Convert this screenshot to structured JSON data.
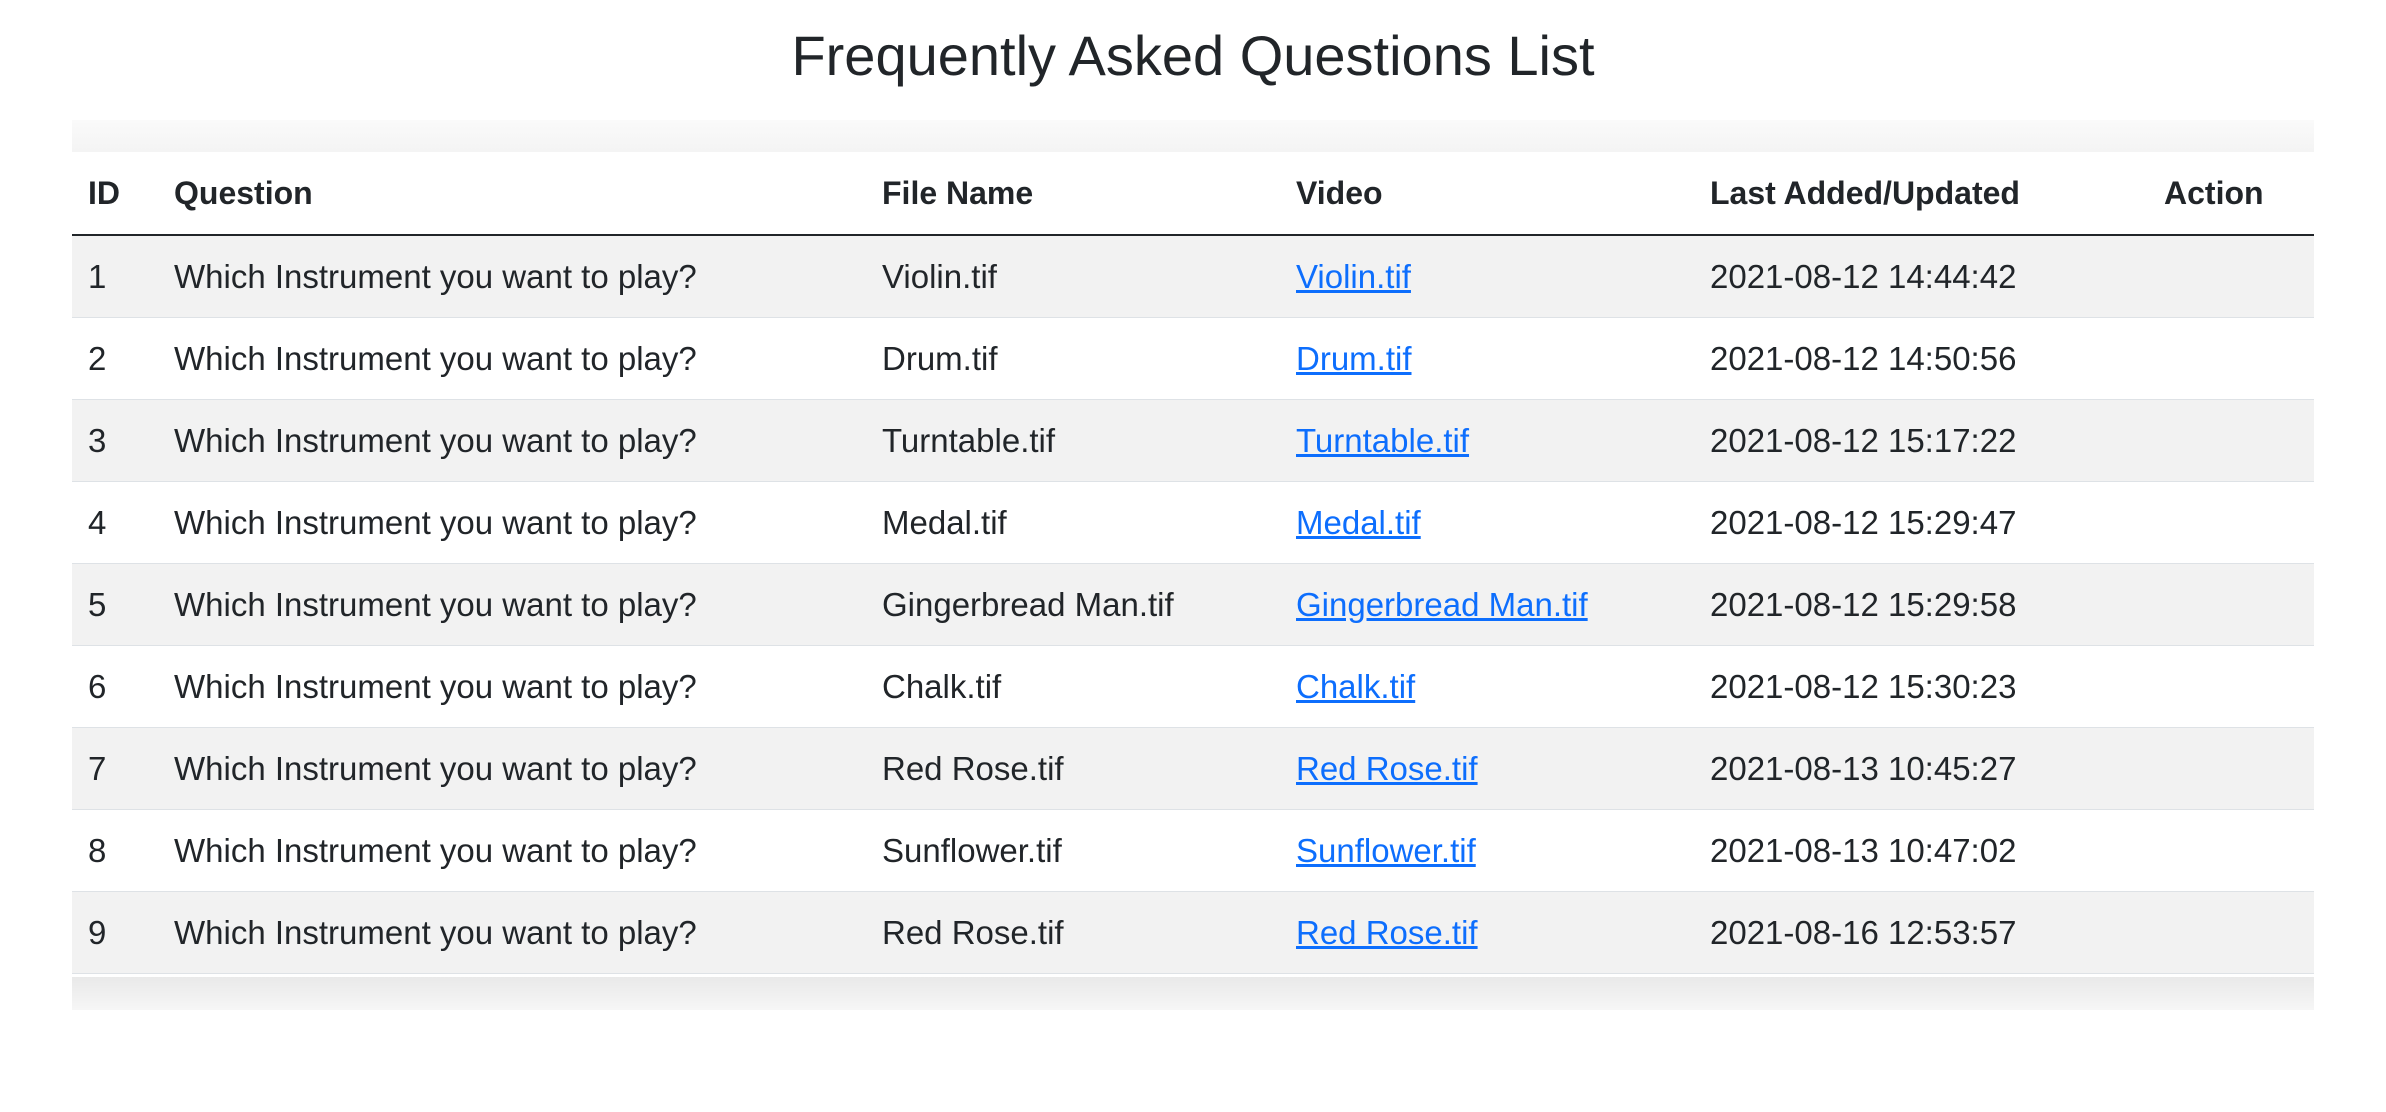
{
  "page": {
    "title": "Frequently Asked Questions List"
  },
  "table": {
    "headers": {
      "id": "ID",
      "question": "Question",
      "file_name": "File Name",
      "video": "Video",
      "last_updated": "Last Added/Updated",
      "action": "Action"
    },
    "rows": [
      {
        "id": "1",
        "question": "Which Instrument you want to play?",
        "file_name": "Violin.tif",
        "video": "Violin.tif",
        "last_updated": "2021-08-12 14:44:42"
      },
      {
        "id": "2",
        "question": "Which Instrument you want to play?",
        "file_name": "Drum.tif",
        "video": "Drum.tif",
        "last_updated": "2021-08-12 14:50:56"
      },
      {
        "id": "3",
        "question": "Which Instrument you want to play?",
        "file_name": "Turntable.tif",
        "video": "Turntable.tif",
        "last_updated": "2021-08-12 15:17:22"
      },
      {
        "id": "4",
        "question": "Which Instrument you want to play?",
        "file_name": "Medal.tif",
        "video": "Medal.tif",
        "last_updated": "2021-08-12 15:29:47"
      },
      {
        "id": "5",
        "question": "Which Instrument you want to play?",
        "file_name": "Gingerbread Man.tif",
        "video": "Gingerbread Man.tif",
        "last_updated": "2021-08-12 15:29:58"
      },
      {
        "id": "6",
        "question": "Which Instrument you want to play?",
        "file_name": "Chalk.tif",
        "video": "Chalk.tif",
        "last_updated": "2021-08-12 15:30:23"
      },
      {
        "id": "7",
        "question": "Which Instrument you want to play?",
        "file_name": "Red Rose.tif",
        "video": "Red Rose.tif",
        "last_updated": "2021-08-13 10:45:27"
      },
      {
        "id": "8",
        "question": "Which Instrument you want to play?",
        "file_name": "Sunflower.tif",
        "video": "Sunflower.tif",
        "last_updated": "2021-08-13 10:47:02"
      },
      {
        "id": "9",
        "question": "Which Instrument you want to play?",
        "file_name": "Red Rose.tif",
        "video": "Red Rose.tif",
        "last_updated": "2021-08-16 12:53:57"
      }
    ]
  },
  "colors": {
    "link": "#0d6efd",
    "stripe": "#f2f2f2",
    "text": "#212529"
  }
}
